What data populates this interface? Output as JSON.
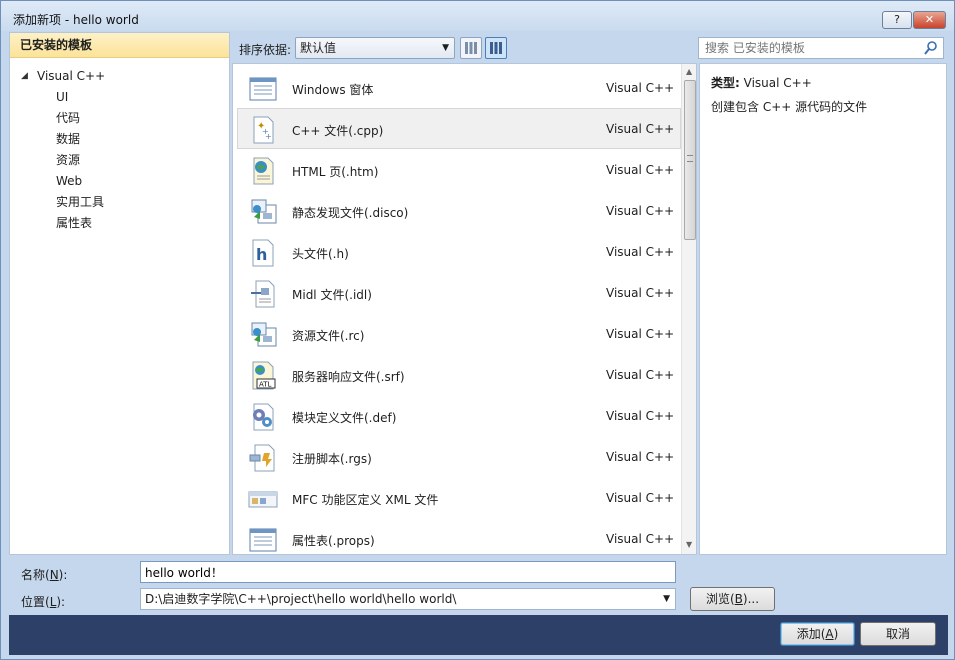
{
  "window": {
    "title": "添加新项 - hello world",
    "help_label": "?",
    "close_label": "✕"
  },
  "sidebar": {
    "header": "已安装的模板",
    "root": "Visual C++",
    "items": [
      "UI",
      "代码",
      "数据",
      "资源",
      "Web",
      "实用工具",
      "属性表"
    ]
  },
  "toolbar": {
    "sort_label": "排序依据:",
    "sort_value": "默认值",
    "search_placeholder": "搜索 已安装的模板"
  },
  "templates": [
    {
      "name": "Windows 窗体",
      "lang": "Visual C++",
      "icon": "windows-form-icon",
      "selected": false
    },
    {
      "name": "C++ 文件(.cpp)",
      "lang": "Visual C++",
      "icon": "cpp-file-icon",
      "selected": true
    },
    {
      "name": "HTML 页(.htm)",
      "lang": "Visual C++",
      "icon": "html-page-icon",
      "selected": false
    },
    {
      "name": "静态发现文件(.disco)",
      "lang": "Visual C++",
      "icon": "disco-file-icon",
      "selected": false
    },
    {
      "name": "头文件(.h)",
      "lang": "Visual C++",
      "icon": "header-file-icon",
      "selected": false
    },
    {
      "name": "Midl 文件(.idl)",
      "lang": "Visual C++",
      "icon": "midl-file-icon",
      "selected": false
    },
    {
      "name": "资源文件(.rc)",
      "lang": "Visual C++",
      "icon": "resource-file-icon",
      "selected": false
    },
    {
      "name": "服务器响应文件(.srf)",
      "lang": "Visual C++",
      "icon": "atl-srf-icon",
      "selected": false
    },
    {
      "name": "模块定义文件(.def)",
      "lang": "Visual C++",
      "icon": "def-file-icon",
      "selected": false
    },
    {
      "name": "注册脚本(.rgs)",
      "lang": "Visual C++",
      "icon": "rgs-script-icon",
      "selected": false
    },
    {
      "name": "MFC 功能区定义 XML 文件",
      "lang": "Visual C++",
      "icon": "mfc-ribbon-icon",
      "selected": false
    },
    {
      "name": "属性表(.props)",
      "lang": "Visual C++",
      "icon": "property-sheet-icon",
      "selected": false
    }
  ],
  "detail": {
    "type_label": "类型:",
    "type_value": "Visual C++",
    "description": "创建包含 C++ 源代码的文件"
  },
  "form": {
    "name_label_pre": "名称(",
    "name_label_key": "N",
    "name_label_post": "):",
    "name_value": "hello world！",
    "location_label_pre": "位置(",
    "location_label_key": "L",
    "location_label_post": "):",
    "location_value": "D:\\启迪数字学院\\C++\\project\\hello world\\hello world\\",
    "browse_pre": "浏览(",
    "browse_key": "B",
    "browse_post": ")..."
  },
  "footer": {
    "add_pre": "添加(",
    "add_key": "A",
    "add_post": ")",
    "cancel_label": "取消"
  },
  "colors": {
    "accent_border": "#3c7fb1",
    "header_highlight": "#fbe39a",
    "footer_bg": "#2d4168"
  }
}
